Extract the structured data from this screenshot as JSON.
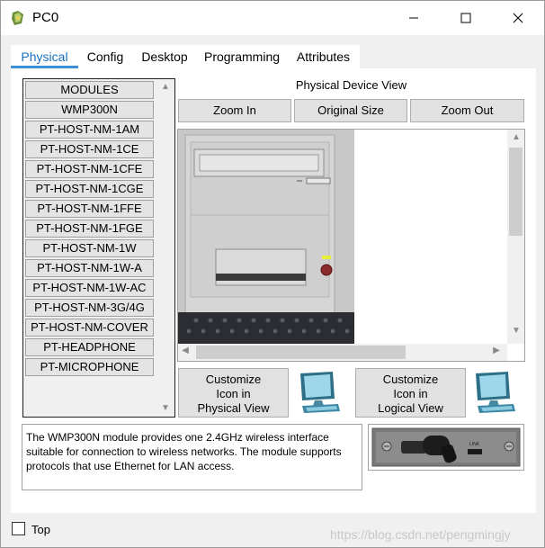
{
  "window": {
    "title": "PC0"
  },
  "tabs": [
    {
      "label": "Physical",
      "active": true
    },
    {
      "label": "Config",
      "active": false
    },
    {
      "label": "Desktop",
      "active": false
    },
    {
      "label": "Programming",
      "active": false
    },
    {
      "label": "Attributes",
      "active": false
    }
  ],
  "modules": {
    "items": [
      "MODULES",
      "WMP300N",
      "PT-HOST-NM-1AM",
      "PT-HOST-NM-1CE",
      "PT-HOST-NM-1CFE",
      "PT-HOST-NM-1CGE",
      "PT-HOST-NM-1FFE",
      "PT-HOST-NM-1FGE",
      "PT-HOST-NM-1W",
      "PT-HOST-NM-1W-A",
      "PT-HOST-NM-1W-AC",
      "PT-HOST-NM-3G/4G",
      "PT-HOST-NM-COVER",
      "PT-HEADPHONE",
      "PT-MICROPHONE"
    ]
  },
  "physical_view": {
    "label": "Physical Device View",
    "zoom_in": "Zoom In",
    "original_size": "Original Size",
    "zoom_out": "Zoom Out"
  },
  "customize": {
    "physical_line1": "Customize",
    "physical_line2": "Icon in",
    "physical_line3": "Physical View",
    "logical_line1": "Customize",
    "logical_line2": "Icon in",
    "logical_line3": "Logical View"
  },
  "description": "The WMP300N module provides one 2.4GHz wireless interface suitable for connection to wireless networks. The module supports protocols that use Ethernet for LAN access.",
  "module_image": {
    "port_label": "LINK"
  },
  "footer": {
    "top_label": "Top",
    "top_checked": false,
    "watermark": "https://blog.csdn.net/pengmingjy"
  },
  "colors": {
    "accent": "#3d8fd6",
    "tab_active_text": "#1a6fc2"
  }
}
